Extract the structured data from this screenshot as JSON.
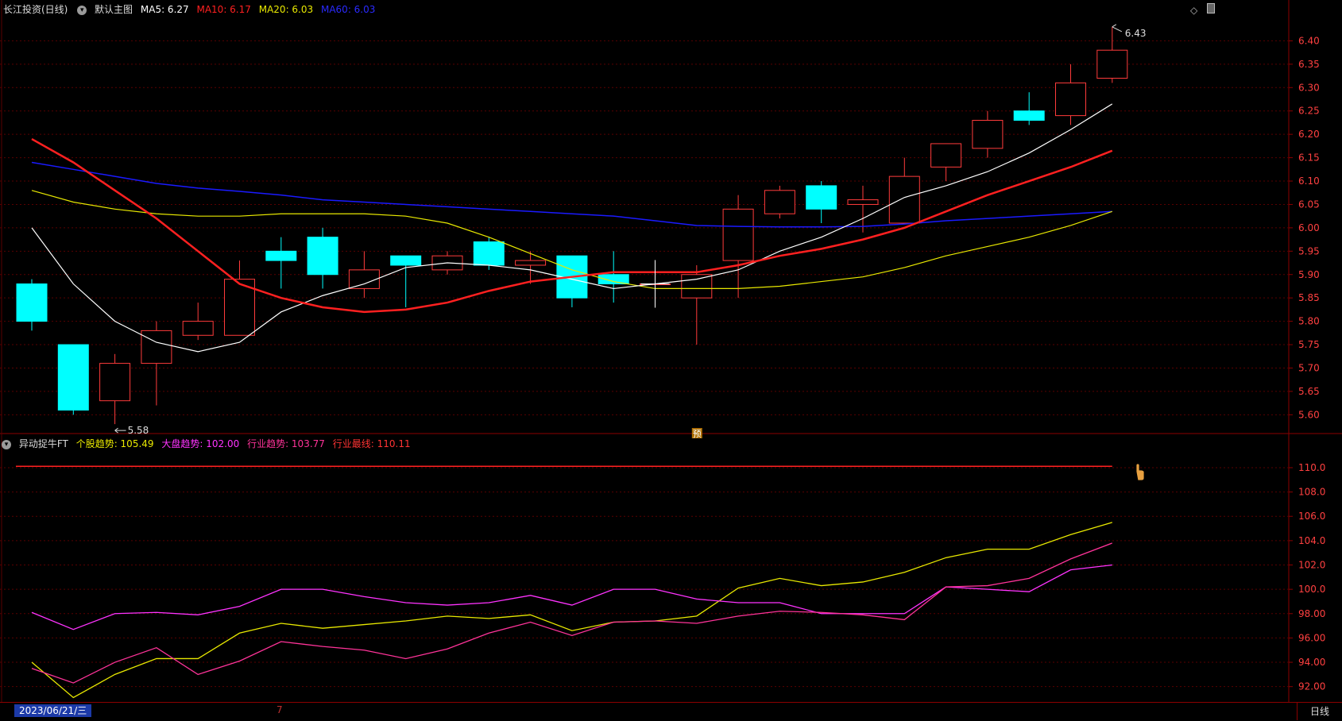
{
  "header": {
    "stock_title": "长江投资(日线)",
    "main_label": "默认主图",
    "ma5": "MA5: 6.27",
    "ma10": "MA10: 6.17",
    "ma20": "MA20: 6.03",
    "ma60": "MA60: 6.03"
  },
  "indicator_header": {
    "name": "异动捉牛FT",
    "stock_trend": "个股趋势: 105.49",
    "market_trend": "大盘趋势: 102.00",
    "industry_trend": "行业趋势: 103.77",
    "industry_top": "行业最线: 110.11"
  },
  "footer": {
    "date": "2023/06/21/三",
    "period": "日线",
    "mark": "7"
  },
  "colors": {
    "up": "#ff3b3b",
    "down": "#00ffff",
    "ma5": "#ffffff",
    "ma10": "#ff2020",
    "ma20": "#e8e800",
    "ma60": "#1a1aff",
    "stock_trend": "#e8e800",
    "market_trend": "#ff33ff",
    "industry_trend": "#ff3399",
    "grid": "#5a0000"
  },
  "chart_data": [
    {
      "type": "candlestick",
      "ylim": [
        5.57,
        6.45
      ],
      "yticks": [
        "6.40",
        "6.35",
        "6.30",
        "6.25",
        "6.20",
        "6.15",
        "6.10",
        "6.05",
        "6.00",
        "5.95",
        "5.90",
        "5.85",
        "5.80",
        "5.75",
        "5.70",
        "5.65",
        "5.60"
      ],
      "annotations": {
        "high": "6.43",
        "low": "5.58",
        "pre_marker": "预"
      },
      "candles": [
        {
          "o": 5.88,
          "h": 5.89,
          "l": 5.78,
          "c": 5.8
        },
        {
          "o": 5.75,
          "h": 5.75,
          "l": 5.6,
          "c": 5.61
        },
        {
          "o": 5.63,
          "h": 5.73,
          "l": 5.58,
          "c": 5.71
        },
        {
          "o": 5.71,
          "h": 5.8,
          "l": 5.62,
          "c": 5.78
        },
        {
          "o": 5.77,
          "h": 5.84,
          "l": 5.76,
          "c": 5.8
        },
        {
          "o": 5.77,
          "h": 5.93,
          "l": 5.77,
          "c": 5.89
        },
        {
          "o": 5.95,
          "h": 5.98,
          "l": 5.87,
          "c": 5.93
        },
        {
          "o": 5.98,
          "h": 6.0,
          "l": 5.87,
          "c": 5.9
        },
        {
          "o": 5.87,
          "h": 5.95,
          "l": 5.85,
          "c": 5.91
        },
        {
          "o": 5.94,
          "h": 5.94,
          "l": 5.83,
          "c": 5.92
        },
        {
          "o": 5.91,
          "h": 5.95,
          "l": 5.9,
          "c": 5.94
        },
        {
          "o": 5.97,
          "h": 5.98,
          "l": 5.91,
          "c": 5.92
        },
        {
          "o": 5.92,
          "h": 5.95,
          "l": 5.88,
          "c": 5.93
        },
        {
          "o": 5.94,
          "h": 5.94,
          "l": 5.83,
          "c": 5.85
        },
        {
          "o": 5.9,
          "h": 5.95,
          "l": 5.84,
          "c": 5.88
        },
        {
          "o": 5.88,
          "h": 5.93,
          "l": 5.84,
          "c": 5.88
        },
        {
          "o": 5.85,
          "h": 5.92,
          "l": 5.75,
          "c": 5.9
        },
        {
          "o": 5.93,
          "h": 6.07,
          "l": 5.85,
          "c": 6.04
        },
        {
          "o": 6.03,
          "h": 6.09,
          "l": 6.02,
          "c": 6.08
        },
        {
          "o": 6.09,
          "h": 6.1,
          "l": 6.01,
          "c": 6.04
        },
        {
          "o": 6.05,
          "h": 6.09,
          "l": 5.99,
          "c": 6.06
        },
        {
          "o": 6.01,
          "h": 6.15,
          "l": 6.01,
          "c": 6.11
        },
        {
          "o": 6.13,
          "h": 6.18,
          "l": 6.1,
          "c": 6.18
        },
        {
          "o": 6.17,
          "h": 6.25,
          "l": 6.15,
          "c": 6.23
        },
        {
          "o": 6.25,
          "h": 6.29,
          "l": 6.22,
          "c": 6.23
        },
        {
          "o": 6.24,
          "h": 6.35,
          "l": 6.22,
          "c": 6.31
        },
        {
          "o": 6.32,
          "h": 6.43,
          "l": 6.31,
          "c": 6.38
        }
      ],
      "ma5": [
        6.0,
        5.88,
        5.8,
        5.755,
        5.735,
        5.755,
        5.82,
        5.855,
        5.88,
        5.915,
        5.925,
        5.92,
        5.91,
        5.89,
        5.87,
        5.88,
        5.89,
        5.91,
        5.95,
        5.98,
        6.02,
        6.065,
        6.09,
        6.12,
        6.16,
        6.21,
        6.265
      ],
      "ma10": [
        6.19,
        6.14,
        6.08,
        6.02,
        5.95,
        5.88,
        5.85,
        5.83,
        5.82,
        5.825,
        5.84,
        5.865,
        5.885,
        5.895,
        5.905,
        5.905,
        5.905,
        5.92,
        5.94,
        5.955,
        5.975,
        6.0,
        6.035,
        6.07,
        6.1,
        6.13,
        6.165
      ],
      "ma20": [
        6.08,
        6.055,
        6.04,
        6.03,
        6.025,
        6.025,
        6.03,
        6.03,
        6.03,
        6.025,
        6.01,
        5.98,
        5.945,
        5.91,
        5.885,
        5.87,
        5.87,
        5.87,
        5.875,
        5.885,
        5.895,
        5.915,
        5.94,
        5.96,
        5.98,
        6.005,
        6.035
      ],
      "ma60": [
        6.14,
        6.125,
        6.11,
        6.095,
        6.085,
        6.078,
        6.07,
        6.06,
        6.055,
        6.05,
        6.045,
        6.04,
        6.035,
        6.03,
        6.025,
        6.015,
        6.005,
        6.003,
        6.002,
        6.002,
        6.003,
        6.008,
        6.015,
        6.02,
        6.025,
        6.03,
        6.035
      ]
    },
    {
      "type": "line",
      "ylim": [
        91.0,
        111.5
      ],
      "yticks": [
        "110.0",
        "108.0",
        "106.0",
        "104.0",
        "102.0",
        "100.0",
        "98.00",
        "96.00",
        "94.00",
        "92.00"
      ],
      "reference_level": 110.11,
      "series": [
        {
          "name": "个股趋势",
          "values": [
            94.0,
            91.1,
            93.0,
            94.3,
            94.3,
            96.4,
            97.2,
            96.8,
            97.1,
            97.4,
            97.8,
            97.6,
            97.9,
            96.6,
            97.3,
            97.4,
            97.8,
            100.1,
            100.9,
            100.3,
            100.6,
            101.4,
            102.6,
            103.3,
            103.3,
            104.5,
            105.5
          ]
        },
        {
          "name": "大盘趋势",
          "values": [
            98.1,
            96.7,
            98.0,
            98.1,
            97.9,
            98.6,
            100.0,
            100.0,
            99.4,
            98.9,
            98.7,
            98.9,
            99.5,
            98.7,
            100.0,
            100.0,
            99.2,
            98.9,
            98.9,
            98.0,
            98.0,
            98.0,
            100.2,
            100.0,
            99.8,
            101.6,
            102.0
          ]
        },
        {
          "name": "行业趋势",
          "values": [
            93.5,
            92.3,
            94.0,
            95.2,
            93.0,
            94.1,
            95.7,
            95.3,
            95.0,
            94.3,
            95.1,
            96.4,
            97.3,
            96.2,
            97.3,
            97.4,
            97.2,
            97.8,
            98.2,
            98.1,
            97.9,
            97.5,
            100.2,
            100.3,
            100.9,
            102.5,
            103.8
          ]
        }
      ]
    }
  ]
}
